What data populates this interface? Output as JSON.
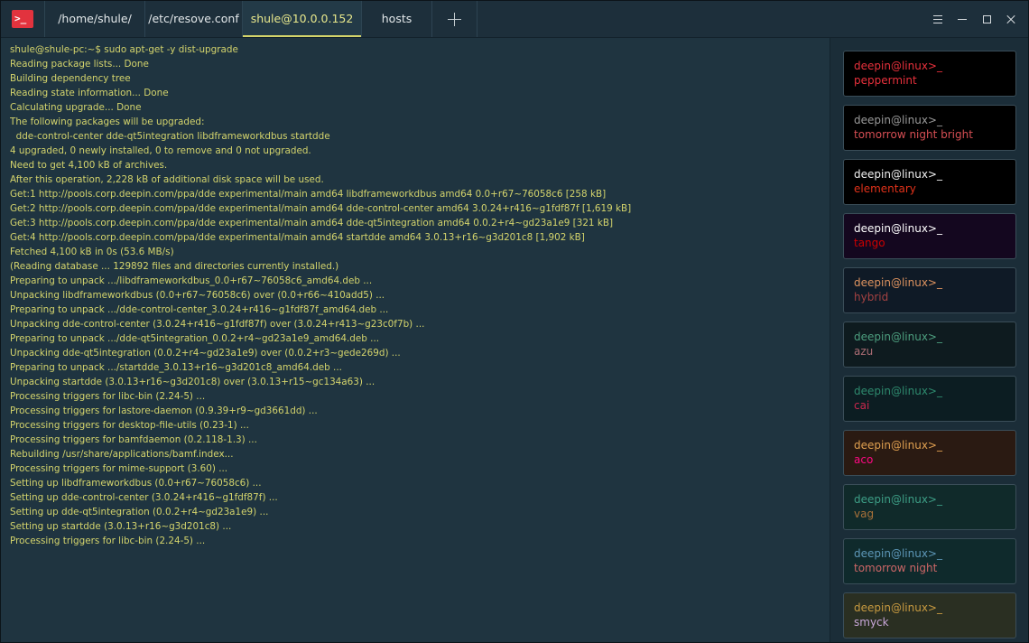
{
  "app": {
    "logo_glyph": ">_",
    "accent": "#e2333e"
  },
  "tabs": [
    {
      "label": "/home/shule/",
      "active": false
    },
    {
      "label": "/etc/resove.conf",
      "active": false
    },
    {
      "label": "shule@10.0.0.152",
      "active": true
    },
    {
      "label": "hosts",
      "active": false
    }
  ],
  "window_controls": [
    "menu-icon",
    "minimize-icon",
    "maximize-icon",
    "close-icon"
  ],
  "terminal": {
    "text_color": "#d4d46c",
    "lines": [
      "shule@shule-pc:~$ sudo apt-get -y dist-upgrade",
      "Reading package lists... Done",
      "Building dependency tree",
      "Reading state information... Done",
      "Calculating upgrade... Done",
      "The following packages will be upgraded:",
      "  dde-control-center dde-qt5integration libdframeworkdbus startdde",
      "4 upgraded, 0 newly installed, 0 to remove and 0 not upgraded.",
      "Need to get 4,100 kB of archives.",
      "After this operation, 2,228 kB of additional disk space will be used.",
      "Get:1 http://pools.corp.deepin.com/ppa/dde experimental/main amd64 libdframeworkdbus amd64 0.0+r67~76058c6 [258 kB]",
      "Get:2 http://pools.corp.deepin.com/ppa/dde experimental/main amd64 dde-control-center amd64 3.0.24+r416~g1fdf87f [1,619 kB]",
      "Get:3 http://pools.corp.deepin.com/ppa/dde experimental/main amd64 dde-qt5integration amd64 0.0.2+r4~gd23a1e9 [321 kB]",
      "Get:4 http://pools.corp.deepin.com/ppa/dde experimental/main amd64 startdde amd64 3.0.13+r16~g3d201c8 [1,902 kB]",
      "Fetched 4,100 kB in 0s (53.6 MB/s)",
      "(Reading database ... 129892 files and directories currently installed.)",
      "Preparing to unpack .../libdframeworkdbus_0.0+r67~76058c6_amd64.deb ...",
      "Unpacking libdframeworkdbus (0.0+r67~76058c6) over (0.0+r66~410add5) ...",
      "Preparing to unpack .../dde-control-center_3.0.24+r416~g1fdf87f_amd64.deb ...",
      "Unpacking dde-control-center (3.0.24+r416~g1fdf87f) over (3.0.24+r413~g23c0f7b) ...",
      "Preparing to unpack .../dde-qt5integration_0.0.2+r4~gd23a1e9_amd64.deb ...",
      "Unpacking dde-qt5integration (0.0.2+r4~gd23a1e9) over (0.0.2+r3~gede269d) ...",
      "Preparing to unpack .../startdde_3.0.13+r16~g3d201c8_amd64.deb ...",
      "Unpacking startdde (3.0.13+r16~g3d201c8) over (3.0.13+r15~gc134a63) ...",
      "Processing triggers for libc-bin (2.24-5) ...",
      "Processing triggers for lastore-daemon (0.9.39+r9~gd3661dd) ...",
      "Processing triggers for desktop-file-utils (0.23-1) ...",
      "Processing triggers for bamfdaemon (0.2.118-1.3) ...",
      "Rebuilding /usr/share/applications/bamf.index...",
      "Processing triggers for mime-support (3.60) ...",
      "Setting up libdframeworkdbus (0.0+r67~76058c6) ...",
      "Setting up dde-control-center (3.0.24+r416~g1fdf87f) ...",
      "Setting up dde-qt5integration (0.0.2+r4~gd23a1e9) ...",
      "Setting up startdde (3.0.13+r16~g3d201c8) ...",
      "Processing triggers for libc-bin (2.24-5) ..."
    ]
  },
  "themes": [
    {
      "prompt": "deepin@linux>_",
      "name": "peppermint",
      "bg": "#000000",
      "prompt_color": "#e8313c",
      "name_color": "#e8313c"
    },
    {
      "prompt": "deepin@linux>_",
      "name": "tomorrow night bright",
      "bg": "#000000",
      "prompt_color": "#9a9a9a",
      "name_color": "#d54e53"
    },
    {
      "prompt": "deepin@linux>_",
      "name": "elementary",
      "bg": "#000000",
      "prompt_color": "#f2f2f2",
      "name_color": "#e1321a"
    },
    {
      "prompt": "deepin@linux>_",
      "name": "tango",
      "bg": "#14071f",
      "prompt_color": "#ffffff",
      "name_color": "#cc0000"
    },
    {
      "prompt": "deepin@linux>_",
      "name": "hybrid",
      "bg": "#0f1a26",
      "prompt_color": "#de935f",
      "name_color": "#a54242"
    },
    {
      "prompt": "deepin@linux>_",
      "name": "azu",
      "bg": "#0e1b1f",
      "prompt_color": "#4d9f7f",
      "name_color": "#ac6d74"
    },
    {
      "prompt": "deepin@linux>_",
      "name": "cai",
      "bg": "#0c1d22",
      "prompt_color": "#2e8a6e",
      "name_color": "#ca274d"
    },
    {
      "prompt": "deepin@linux>_",
      "name": "aco",
      "bg": "#2a1a12",
      "prompt_color": "#e0a050",
      "name_color": "#ff0883"
    },
    {
      "prompt": "deepin@linux>_",
      "name": "vag",
      "bg": "#102a2a",
      "prompt_color": "#3d9e86",
      "name_color": "#a87139"
    },
    {
      "prompt": "deepin@linux>_",
      "name": "tomorrow night",
      "bg": "#0f2a2c",
      "prompt_color": "#5d97b8",
      "name_color": "#cc6666"
    },
    {
      "prompt": "deepin@linux>_",
      "name": "smyck",
      "bg": "#2a2f22",
      "prompt_color": "#c89a40",
      "name_color": "#c8a6d8"
    }
  ]
}
